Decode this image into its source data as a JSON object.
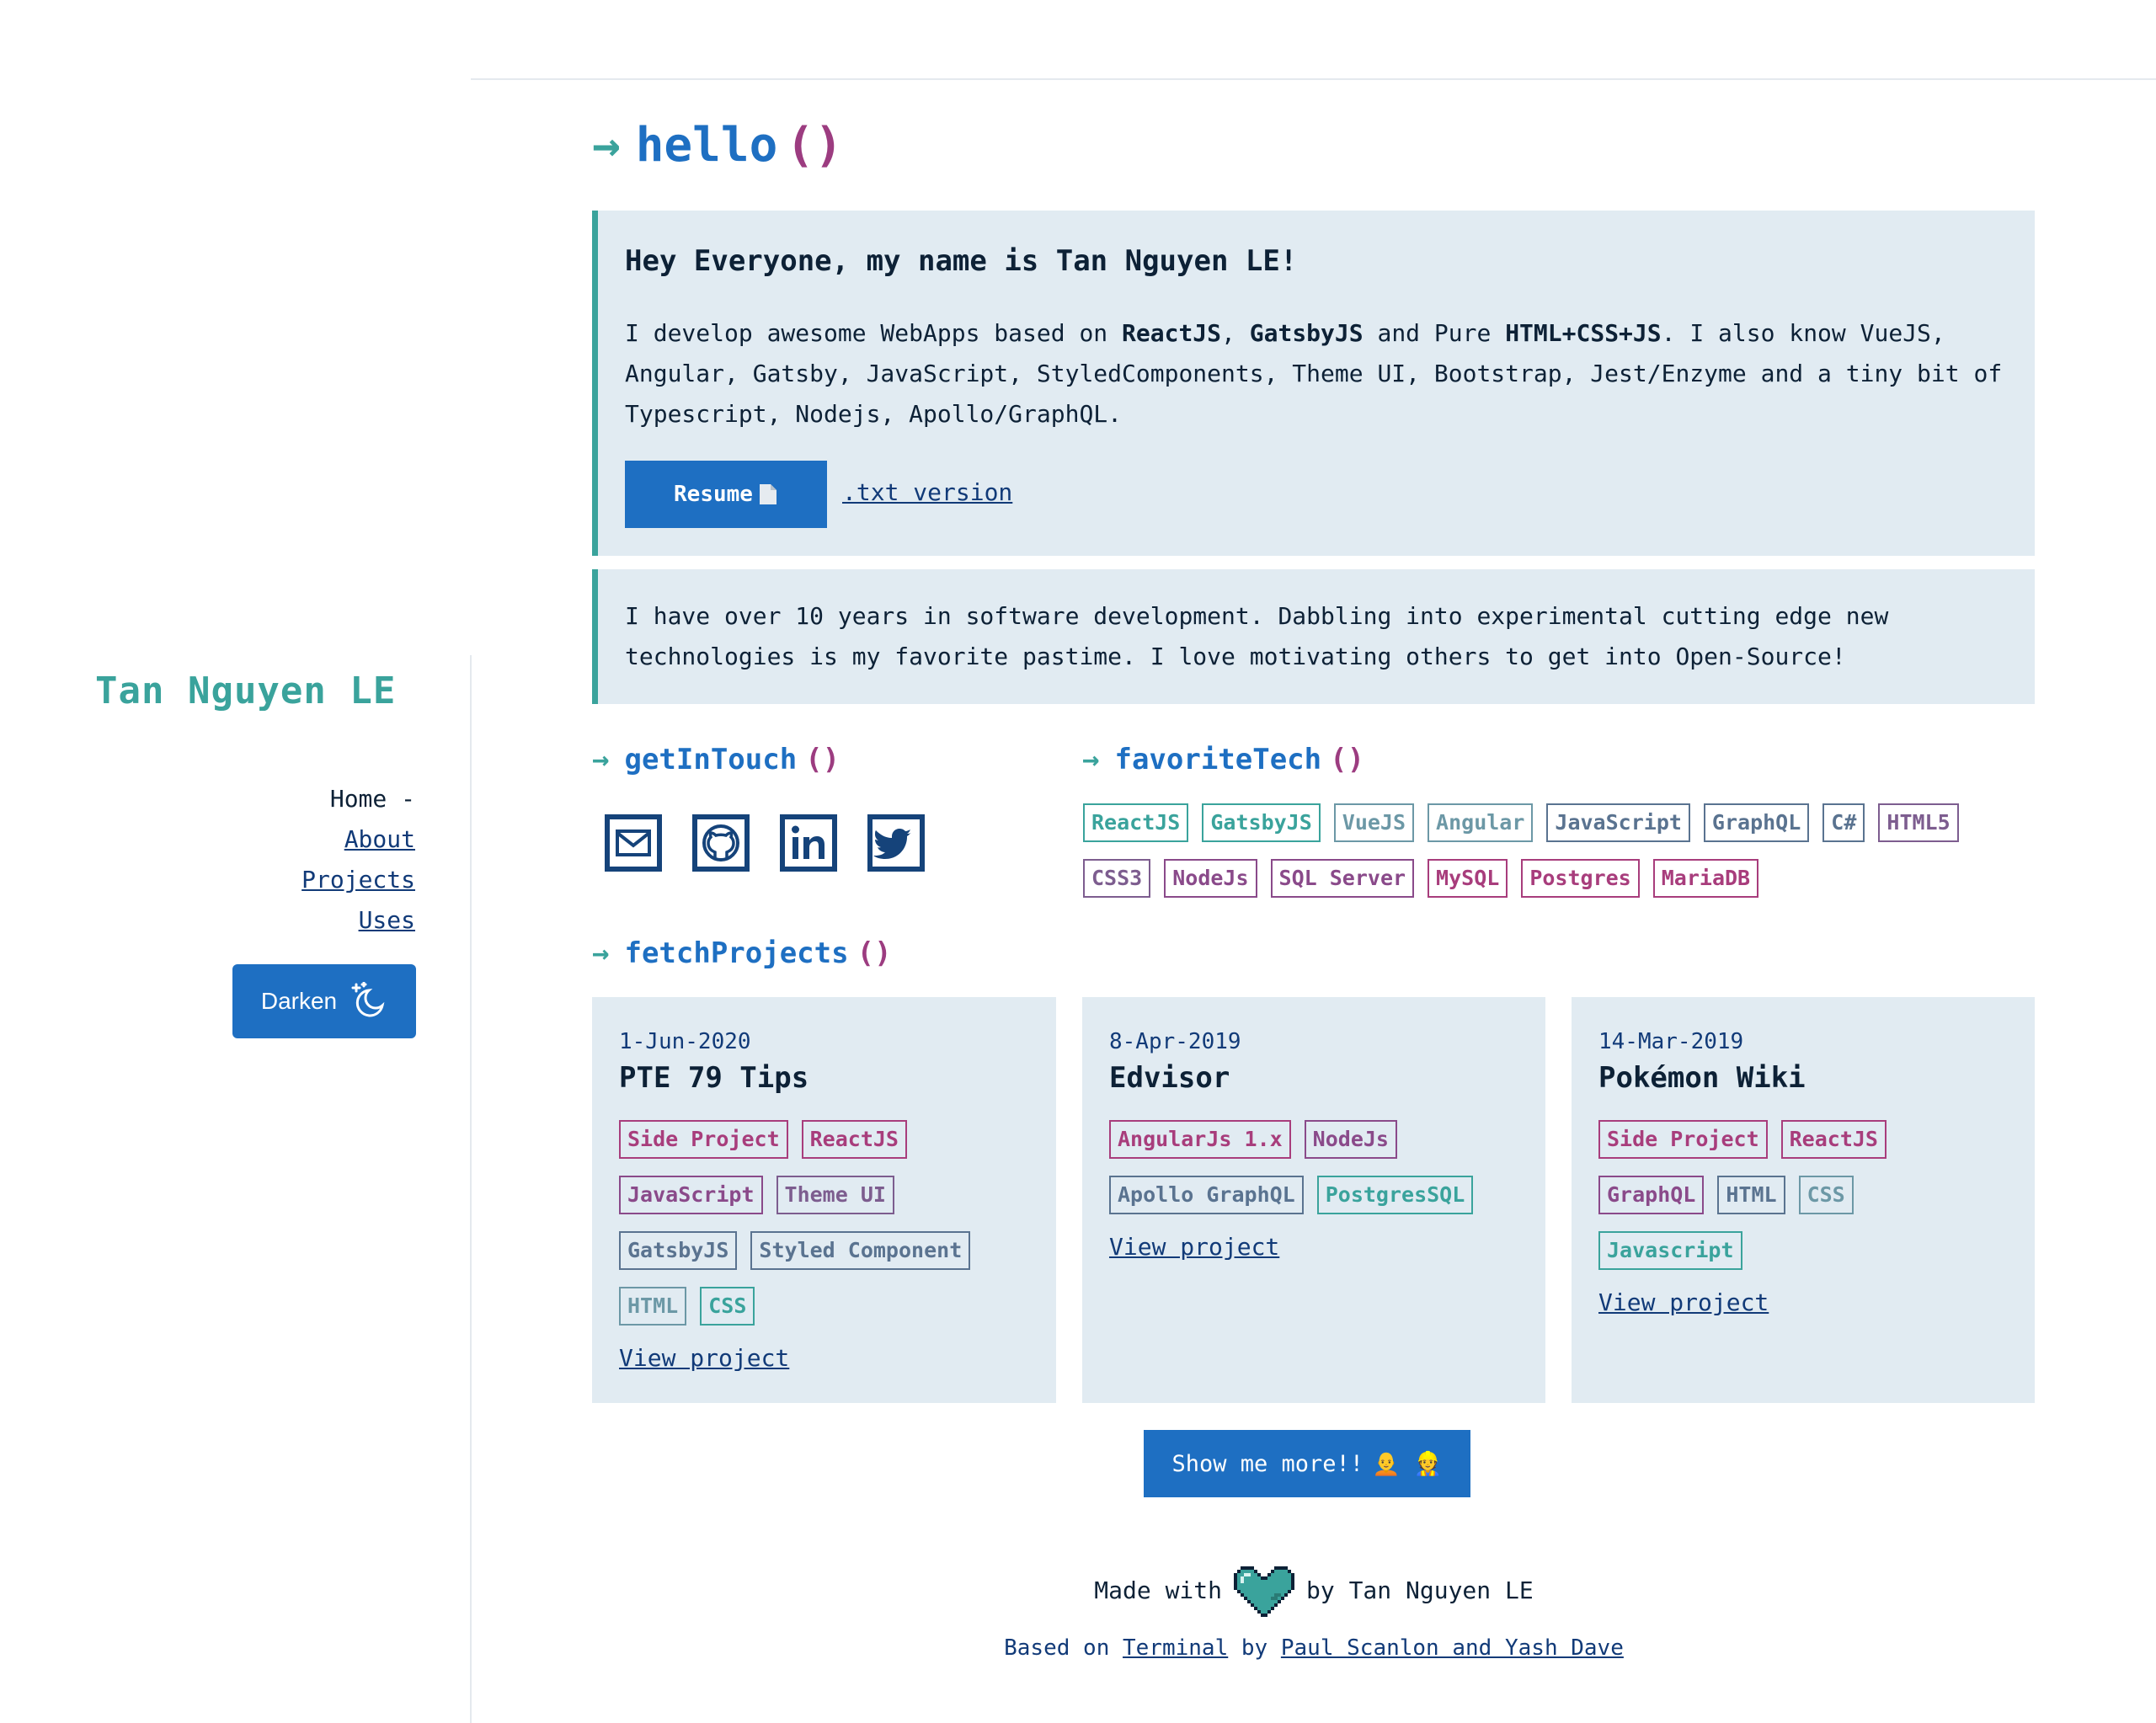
{
  "sidebar": {
    "site_title": "Tan Nguyen LE",
    "nav": [
      {
        "label": "Home -",
        "current": true
      },
      {
        "label": "About"
      },
      {
        "label": "Projects"
      },
      {
        "label": "Uses"
      }
    ],
    "darken_label": "Darken"
  },
  "hello": {
    "title": "hello"
  },
  "intro": {
    "greeting": "Hey Everyone, my name is Tan Nguyen LE!",
    "p_start": "I develop awesome WebApps based on ",
    "b1": "ReactJS",
    "sep1": ", ",
    "b2": "GatsbyJS",
    "mid": " and Pure ",
    "b3": "HTML+CSS+JS",
    "p_end": ". I also know VueJS, Angular, Gatsby, JavaScript, StyledComponents, Theme UI, Bootstrap, Jest/Enzyme and a tiny bit of Typescript, Nodejs, Apollo/GraphQL.",
    "resume_label": "Resume",
    "txt_link": ".txt version"
  },
  "experience": {
    "text": "I have over 10 years in software development. Dabbling into experimental cutting edge new technologies is my favorite pastime. I love motivating others to get into Open-Source!"
  },
  "get_in_touch": {
    "title": "getInTouch",
    "icons": [
      "mail-icon",
      "github-icon",
      "linkedin-icon",
      "twitter-icon"
    ]
  },
  "favorite_tech": {
    "title": "favoriteTech",
    "tags": [
      {
        "label": "ReactJS",
        "style": "t-teal"
      },
      {
        "label": "GatsbyJS",
        "style": "t-teal"
      },
      {
        "label": "VueJS",
        "style": "t-gteal"
      },
      {
        "label": "Angular",
        "style": "t-gteal"
      },
      {
        "label": "JavaScript",
        "style": "t-slate"
      },
      {
        "label": "GraphQL",
        "style": "t-slate"
      },
      {
        "label": "C#",
        "style": "t-slate"
      },
      {
        "label": "HTML5",
        "style": "t-lpurp"
      },
      {
        "label": "CSS3",
        "style": "t-lpurp"
      },
      {
        "label": "NodeJs",
        "style": "t-purple"
      },
      {
        "label": "SQL Server",
        "style": "t-purple"
      },
      {
        "label": "MySQL",
        "style": "t-pink"
      },
      {
        "label": "Postgres",
        "style": "t-pink"
      },
      {
        "label": "MariaDB",
        "style": "t-pink"
      }
    ]
  },
  "fetch_projects": {
    "title": "fetchProjects",
    "projects": [
      {
        "date": "1-Jun-2020",
        "title": "PTE 79 Tips",
        "tags": [
          {
            "label": "Side Project",
            "style": "t-pink"
          },
          {
            "label": "ReactJS",
            "style": "t-pink"
          },
          {
            "label": "JavaScript",
            "style": "t-purple"
          },
          {
            "label": "Theme UI",
            "style": "t-lpurp"
          },
          {
            "label": "GatsbyJS",
            "style": "t-slate"
          },
          {
            "label": "Styled Component",
            "style": "t-slate"
          },
          {
            "label": "HTML",
            "style": "t-gteal"
          },
          {
            "label": "CSS",
            "style": "t-teal"
          }
        ],
        "view": "View project"
      },
      {
        "date": "8-Apr-2019",
        "title": "Edvisor",
        "tags": [
          {
            "label": "AngularJs 1.x",
            "style": "t-pink"
          },
          {
            "label": "NodeJs",
            "style": "t-purple"
          },
          {
            "label": "Apollo GraphQL",
            "style": "t-slate"
          },
          {
            "label": "PostgresSQL",
            "style": "t-teal"
          }
        ],
        "view": "View project"
      },
      {
        "date": "14-Mar-2019",
        "title": "Pokémon Wiki",
        "tags": [
          {
            "label": "Side Project",
            "style": "t-pink"
          },
          {
            "label": "ReactJS",
            "style": "t-pink"
          },
          {
            "label": "GraphQL",
            "style": "t-purple"
          },
          {
            "label": "HTML",
            "style": "t-slate"
          },
          {
            "label": "CSS",
            "style": "t-gteal"
          },
          {
            "label": "Javascript",
            "style": "t-teal"
          }
        ],
        "view": "View project"
      }
    ],
    "more_label": "Show me more!!",
    "more_emoji": "🧑‍🦲 👷"
  },
  "footer": {
    "made_with": "Made with",
    "by": "by Tan Nguyen LE",
    "based_on": "Based on",
    "terminal": "Terminal",
    "by2": "by",
    "authors": "Paul Scanlon and Yash Dave"
  },
  "colors": {
    "accent": "#1e6fc2",
    "teal": "#3aa39c",
    "magenta": "#9c3c80",
    "panel": "#e1ebf2"
  }
}
